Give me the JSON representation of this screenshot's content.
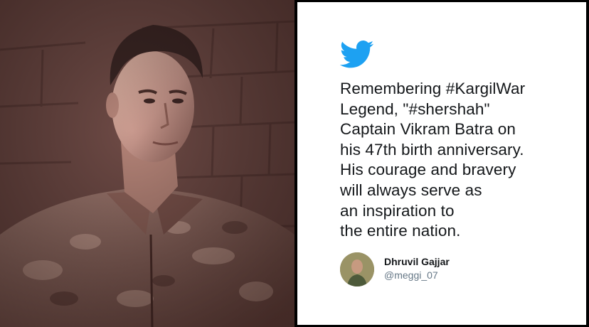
{
  "photo": {
    "subject": "portrait-photo",
    "tint": "#6b4844"
  },
  "tweet": {
    "icon": "twitter-bird-icon",
    "brand_color": "#1da1f2",
    "lines": [
      "Remembering #KargilWar",
      "Legend, \"#shershah\"",
      "Captain Vikram Batra on",
      "his 47th birth anniversary.",
      "His courage and bravery",
      "will always serve as",
      "an inspiration to",
      "the entire nation."
    ],
    "author": {
      "name": "Dhruvil Gajjar",
      "handle": "@meggi_07"
    }
  }
}
